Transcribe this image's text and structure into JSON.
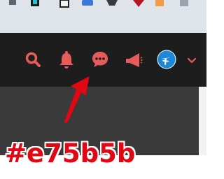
{
  "colors": {
    "accent": "#e75b5b",
    "annotation": "#e30613",
    "header_bg": "#1d1d1d",
    "content_bg": "#3a3a3a",
    "taskbar_bg": "#dfe3ea"
  },
  "taskbar": {
    "icons": [
      "app-tile-icon",
      "s-app-icon",
      "device-icon",
      "puzzle-extension-icon",
      "game-controller-icon",
      "shield-icon",
      "orange-tile-icon",
      "grid-icon"
    ]
  },
  "header": {
    "icons": [
      "search-icon",
      "bell-icon",
      "chat-bubble-icon",
      "megaphone-icon",
      "profile-avatar-icon",
      "chevron-down-icon"
    ]
  },
  "annotation": {
    "text": "#e75b5b"
  }
}
